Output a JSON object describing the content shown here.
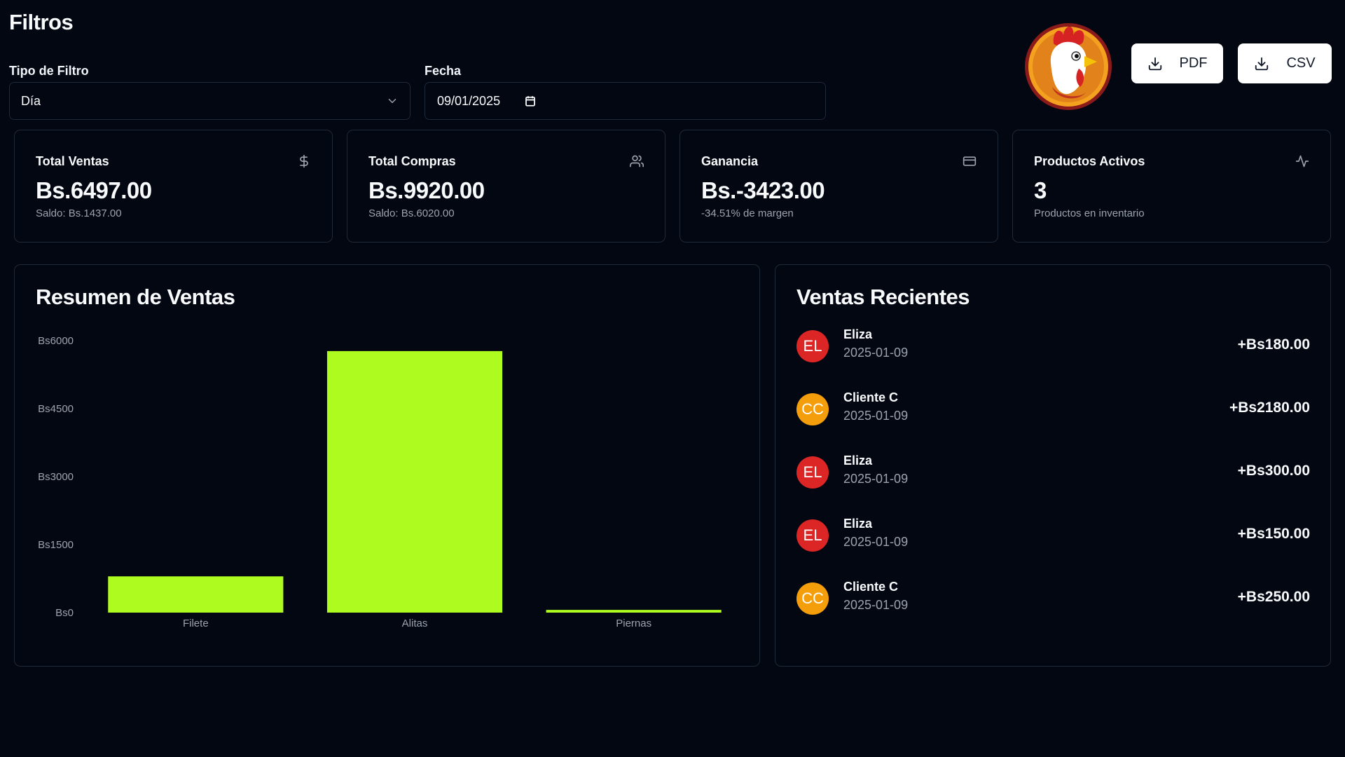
{
  "filters": {
    "title": "Filtros",
    "type_label": "Tipo de Filtro",
    "type_value": "Día",
    "date_label": "Fecha",
    "date_value": "09/01/2025"
  },
  "export": {
    "pdf_label": "PDF",
    "csv_label": "CSV"
  },
  "stats": [
    {
      "title": "Total Ventas",
      "value": "Bs.6497.00",
      "sub": "Saldo: Bs.1437.00",
      "icon": "dollar-icon"
    },
    {
      "title": "Total Compras",
      "value": "Bs.9920.00",
      "sub": "Saldo: Bs.6020.00",
      "icon": "users-icon"
    },
    {
      "title": "Ganancia",
      "value": "Bs.-3423.00",
      "sub": "-34.51% de margen",
      "icon": "credit-card-icon"
    },
    {
      "title": "Productos Activos",
      "value": "3",
      "sub": "Productos en inventario",
      "icon": "activity-icon"
    }
  ],
  "chart_panel": {
    "title": "Resumen de Ventas"
  },
  "chart_data": {
    "type": "bar",
    "categories": [
      "Filete",
      "Alitas",
      "Piernas"
    ],
    "values": [
      800,
      5770,
      60
    ],
    "ylim": [
      0,
      6000
    ],
    "yticks": [
      0,
      1500,
      3000,
      4500,
      6000
    ],
    "ytick_labels": [
      "Bs0",
      "Bs1500",
      "Bs3000",
      "Bs4500",
      "Bs6000"
    ],
    "color": "#aefc1f"
  },
  "recent": {
    "title": "Ventas Recientes",
    "items": [
      {
        "initials": "EL",
        "name": "Eliza",
        "date": "2025-01-09",
        "amount": "+Bs180.00",
        "color": "#dc2626"
      },
      {
        "initials": "CC",
        "name": "Cliente C",
        "date": "2025-01-09",
        "amount": "+Bs2180.00",
        "color": "#f59e0b"
      },
      {
        "initials": "EL",
        "name": "Eliza",
        "date": "2025-01-09",
        "amount": "+Bs300.00",
        "color": "#dc2626"
      },
      {
        "initials": "EL",
        "name": "Eliza",
        "date": "2025-01-09",
        "amount": "+Bs150.00",
        "color": "#dc2626"
      },
      {
        "initials": "CC",
        "name": "Cliente C",
        "date": "2025-01-09",
        "amount": "+Bs250.00",
        "color": "#f59e0b"
      }
    ]
  }
}
